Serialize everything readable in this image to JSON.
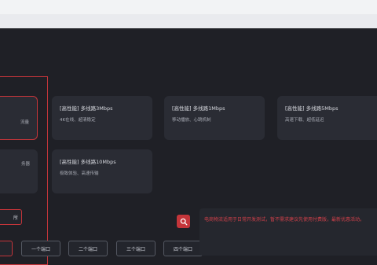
{
  "cards": [
    {
      "title": "",
      "desc": "流量"
    },
    {
      "title": "[高性能] 多线路3Mbps",
      "desc": "4K在线、超清稳定"
    },
    {
      "title": "[高性能] 多线路1Mbps",
      "desc": "移动播放、心跳机制"
    },
    {
      "title": "[高性能] 多线路5Mbps",
      "desc": "高速下载、超低延迟"
    },
    {
      "title": "",
      "desc": "务器"
    },
    {
      "title": "[高性能] 多线路10Mbps",
      "desc": "极致体验、高速传输"
    }
  ],
  "chips": {
    "partial_top": "所",
    "bottom": [
      "",
      "一个端口",
      "二个端口",
      "三个端口",
      "四个端口"
    ]
  },
  "notice": {
    "text": "电商物流适用于日常开发测试，暂不需求建议先使用付费版，最新优惠活动。"
  }
}
